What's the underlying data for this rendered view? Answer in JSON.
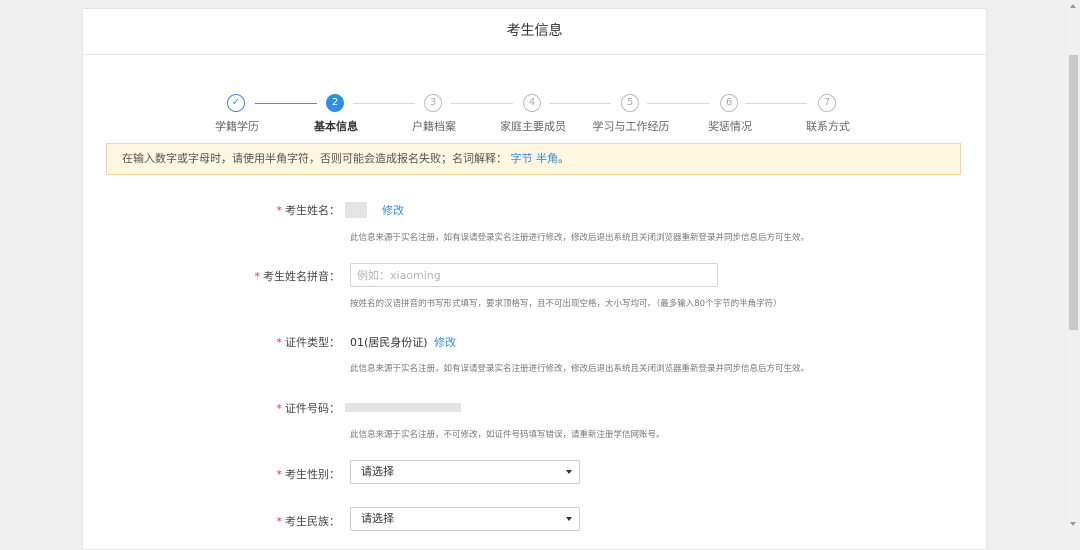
{
  "page": {
    "title": "考生信息"
  },
  "steps": [
    {
      "number": "✓",
      "label": "学籍学历",
      "state": "done"
    },
    {
      "number": "2",
      "label": "基本信息",
      "state": "active"
    },
    {
      "number": "3",
      "label": "户籍档案",
      "state": "todo"
    },
    {
      "number": "4",
      "label": "家庭主要成员",
      "state": "todo"
    },
    {
      "number": "5",
      "label": "学习与工作经历",
      "state": "todo"
    },
    {
      "number": "6",
      "label": "奖惩情况",
      "state": "todo"
    },
    {
      "number": "7",
      "label": "联系方式",
      "state": "todo"
    }
  ],
  "notice": {
    "text": "在输入数字或字母时，请使用半角字符，否则可能会造成报名失败；名词解释：",
    "link1": "字节",
    "link2": "半角",
    "end": "。"
  },
  "form": {
    "required_mark": "*",
    "name": {
      "label": "考生姓名：",
      "edit": "修改",
      "hint": "此信息来源于实名注册，如有误请登录实名注册进行修改，修改后退出系统且关闭浏览器重新登录并同步信息后方可生效。"
    },
    "pinyin": {
      "label": "考生姓名拼音：",
      "placeholder": "例如：xiaoming",
      "hint": "按姓名的汉语拼音的书写形式填写，要求顶格写，且不可出现空格，大小写均可。（最多输入80个字节的半角字符）"
    },
    "id_type": {
      "label": "证件类型：",
      "value": "01(居民身份证)",
      "edit": "修改",
      "hint": "此信息来源于实名注册，如有误请登录实名注册进行修改，修改后退出系统且关闭浏览器重新登录并同步信息后方可生效。"
    },
    "id_number": {
      "label": "证件号码：",
      "hint": "此信息来源于实名注册，不可修改，如证件号码填写错误，请重新注册学信网账号。"
    },
    "gender": {
      "label": "考生性别：",
      "selected": "请选择"
    },
    "ethnicity": {
      "label": "考生民族：",
      "selected": "请选择"
    }
  },
  "colors": {
    "accent": "#2f8fe6",
    "required": "#e4393c",
    "notice_bg": "#fdf6e0"
  },
  "icons": {
    "step_done": "check-icon",
    "select_caret": "caret-down-icon"
  }
}
